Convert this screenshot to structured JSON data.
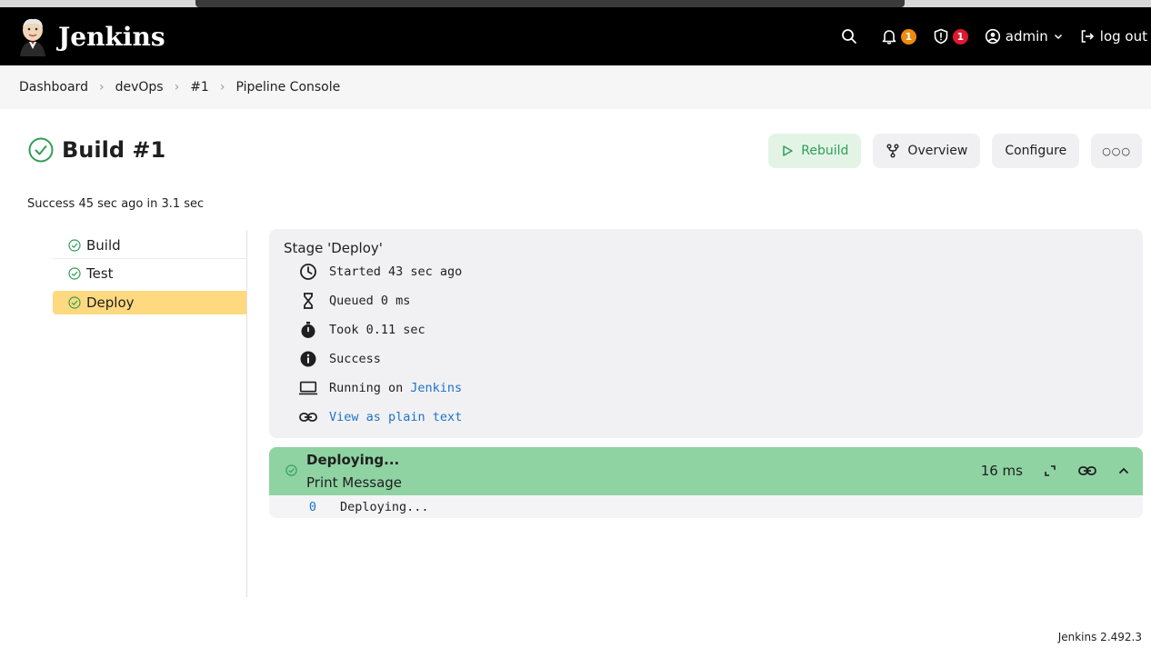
{
  "header": {
    "logo_text": "Jenkins",
    "notifications_count": "1",
    "security_count": "1",
    "user": "admin",
    "logout": "log out",
    "badge_colors": {
      "notifications": "#ef8a0c",
      "security": "#e0182d"
    }
  },
  "breadcrumb": [
    "Dashboard",
    "devOps",
    "#1",
    "Pipeline Console"
  ],
  "build": {
    "title": "Build #1",
    "status": "Success 45 sec ago in 3.1 sec",
    "actions": {
      "rebuild": "Rebuild",
      "overview": "Overview",
      "configure": "Configure",
      "more": "○○○"
    }
  },
  "stages": [
    {
      "name": "Build",
      "active": false
    },
    {
      "name": "Test",
      "active": false
    },
    {
      "name": "Deploy",
      "active": true
    }
  ],
  "stage_detail": {
    "title": "Stage 'Deploy'",
    "started": "Started 43 sec ago",
    "queued": "Queued 0 ms",
    "took": "Took 0.11 sec",
    "result": "Success",
    "running_on_prefix": "Running on",
    "running_on_node": "Jenkins",
    "plain_text_link": "View as plain text"
  },
  "step": {
    "name": "Deploying...",
    "subtitle": "Print Message",
    "duration": "16 ms",
    "log": [
      {
        "line": "0",
        "text": "Deploying..."
      }
    ],
    "color": "#8fd3a3"
  },
  "footer": {
    "version": "Jenkins 2.492.3"
  }
}
